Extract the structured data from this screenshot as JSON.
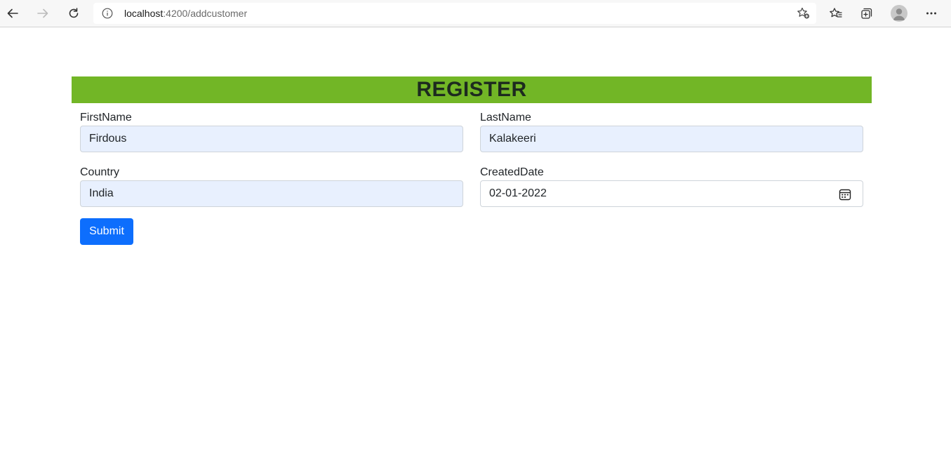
{
  "browser": {
    "url_host": "localhost",
    "url_path": ":4200/addcustomer",
    "icons": [
      "back-icon",
      "forward-icon",
      "reload-icon",
      "info-icon",
      "add-favorite-icon",
      "favorites-icon",
      "collections-icon",
      "profile-avatar",
      "more-icon"
    ]
  },
  "page": {
    "header_title": "REGISTER",
    "header_color": "#72b626",
    "fields": {
      "firstname": {
        "label": "FirstName",
        "value": "Firdous"
      },
      "lastname": {
        "label": "LastName",
        "value": "Kalakeeri"
      },
      "country": {
        "label": "Country",
        "value": "India"
      },
      "createddate": {
        "label": "CreatedDate",
        "value": "02-01-2022"
      }
    },
    "submit_label": "Submit",
    "submit_color": "#0d6efd"
  }
}
